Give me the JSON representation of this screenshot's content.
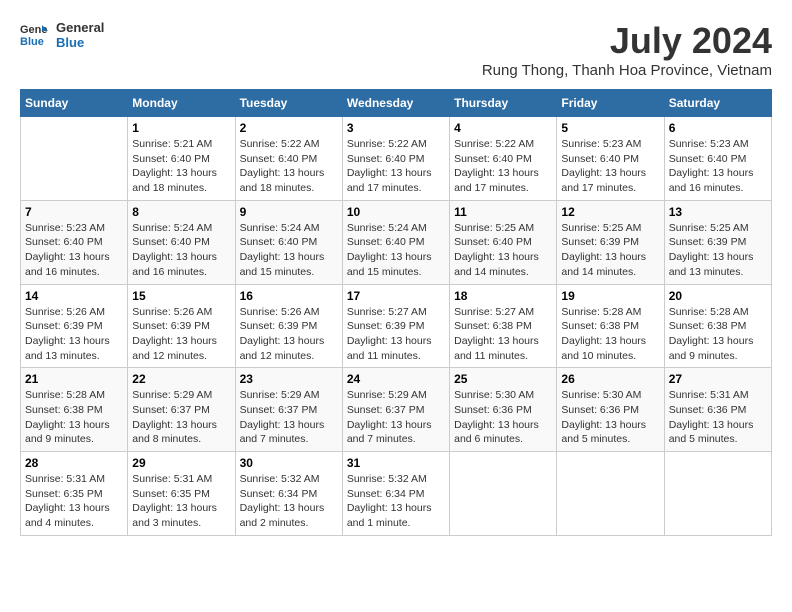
{
  "header": {
    "logo_line1": "General",
    "logo_line2": "Blue",
    "month": "July 2024",
    "location": "Rung Thong, Thanh Hoa Province, Vietnam"
  },
  "weekdays": [
    "Sunday",
    "Monday",
    "Tuesday",
    "Wednesday",
    "Thursday",
    "Friday",
    "Saturday"
  ],
  "weeks": [
    [
      {
        "day": "",
        "detail": ""
      },
      {
        "day": "1",
        "detail": "Sunrise: 5:21 AM\nSunset: 6:40 PM\nDaylight: 13 hours\nand 18 minutes."
      },
      {
        "day": "2",
        "detail": "Sunrise: 5:22 AM\nSunset: 6:40 PM\nDaylight: 13 hours\nand 18 minutes."
      },
      {
        "day": "3",
        "detail": "Sunrise: 5:22 AM\nSunset: 6:40 PM\nDaylight: 13 hours\nand 17 minutes."
      },
      {
        "day": "4",
        "detail": "Sunrise: 5:22 AM\nSunset: 6:40 PM\nDaylight: 13 hours\nand 17 minutes."
      },
      {
        "day": "5",
        "detail": "Sunrise: 5:23 AM\nSunset: 6:40 PM\nDaylight: 13 hours\nand 17 minutes."
      },
      {
        "day": "6",
        "detail": "Sunrise: 5:23 AM\nSunset: 6:40 PM\nDaylight: 13 hours\nand 16 minutes."
      }
    ],
    [
      {
        "day": "7",
        "detail": "Sunrise: 5:23 AM\nSunset: 6:40 PM\nDaylight: 13 hours\nand 16 minutes."
      },
      {
        "day": "8",
        "detail": "Sunrise: 5:24 AM\nSunset: 6:40 PM\nDaylight: 13 hours\nand 16 minutes."
      },
      {
        "day": "9",
        "detail": "Sunrise: 5:24 AM\nSunset: 6:40 PM\nDaylight: 13 hours\nand 15 minutes."
      },
      {
        "day": "10",
        "detail": "Sunrise: 5:24 AM\nSunset: 6:40 PM\nDaylight: 13 hours\nand 15 minutes."
      },
      {
        "day": "11",
        "detail": "Sunrise: 5:25 AM\nSunset: 6:40 PM\nDaylight: 13 hours\nand 14 minutes."
      },
      {
        "day": "12",
        "detail": "Sunrise: 5:25 AM\nSunset: 6:39 PM\nDaylight: 13 hours\nand 14 minutes."
      },
      {
        "day": "13",
        "detail": "Sunrise: 5:25 AM\nSunset: 6:39 PM\nDaylight: 13 hours\nand 13 minutes."
      }
    ],
    [
      {
        "day": "14",
        "detail": "Sunrise: 5:26 AM\nSunset: 6:39 PM\nDaylight: 13 hours\nand 13 minutes."
      },
      {
        "day": "15",
        "detail": "Sunrise: 5:26 AM\nSunset: 6:39 PM\nDaylight: 13 hours\nand 12 minutes."
      },
      {
        "day": "16",
        "detail": "Sunrise: 5:26 AM\nSunset: 6:39 PM\nDaylight: 13 hours\nand 12 minutes."
      },
      {
        "day": "17",
        "detail": "Sunrise: 5:27 AM\nSunset: 6:39 PM\nDaylight: 13 hours\nand 11 minutes."
      },
      {
        "day": "18",
        "detail": "Sunrise: 5:27 AM\nSunset: 6:38 PM\nDaylight: 13 hours\nand 11 minutes."
      },
      {
        "day": "19",
        "detail": "Sunrise: 5:28 AM\nSunset: 6:38 PM\nDaylight: 13 hours\nand 10 minutes."
      },
      {
        "day": "20",
        "detail": "Sunrise: 5:28 AM\nSunset: 6:38 PM\nDaylight: 13 hours\nand 9 minutes."
      }
    ],
    [
      {
        "day": "21",
        "detail": "Sunrise: 5:28 AM\nSunset: 6:38 PM\nDaylight: 13 hours\nand 9 minutes."
      },
      {
        "day": "22",
        "detail": "Sunrise: 5:29 AM\nSunset: 6:37 PM\nDaylight: 13 hours\nand 8 minutes."
      },
      {
        "day": "23",
        "detail": "Sunrise: 5:29 AM\nSunset: 6:37 PM\nDaylight: 13 hours\nand 7 minutes."
      },
      {
        "day": "24",
        "detail": "Sunrise: 5:29 AM\nSunset: 6:37 PM\nDaylight: 13 hours\nand 7 minutes."
      },
      {
        "day": "25",
        "detail": "Sunrise: 5:30 AM\nSunset: 6:36 PM\nDaylight: 13 hours\nand 6 minutes."
      },
      {
        "day": "26",
        "detail": "Sunrise: 5:30 AM\nSunset: 6:36 PM\nDaylight: 13 hours\nand 5 minutes."
      },
      {
        "day": "27",
        "detail": "Sunrise: 5:31 AM\nSunset: 6:36 PM\nDaylight: 13 hours\nand 5 minutes."
      }
    ],
    [
      {
        "day": "28",
        "detail": "Sunrise: 5:31 AM\nSunset: 6:35 PM\nDaylight: 13 hours\nand 4 minutes."
      },
      {
        "day": "29",
        "detail": "Sunrise: 5:31 AM\nSunset: 6:35 PM\nDaylight: 13 hours\nand 3 minutes."
      },
      {
        "day": "30",
        "detail": "Sunrise: 5:32 AM\nSunset: 6:34 PM\nDaylight: 13 hours\nand 2 minutes."
      },
      {
        "day": "31",
        "detail": "Sunrise: 5:32 AM\nSunset: 6:34 PM\nDaylight: 13 hours\nand 1 minute."
      },
      {
        "day": "",
        "detail": ""
      },
      {
        "day": "",
        "detail": ""
      },
      {
        "day": "",
        "detail": ""
      }
    ]
  ]
}
